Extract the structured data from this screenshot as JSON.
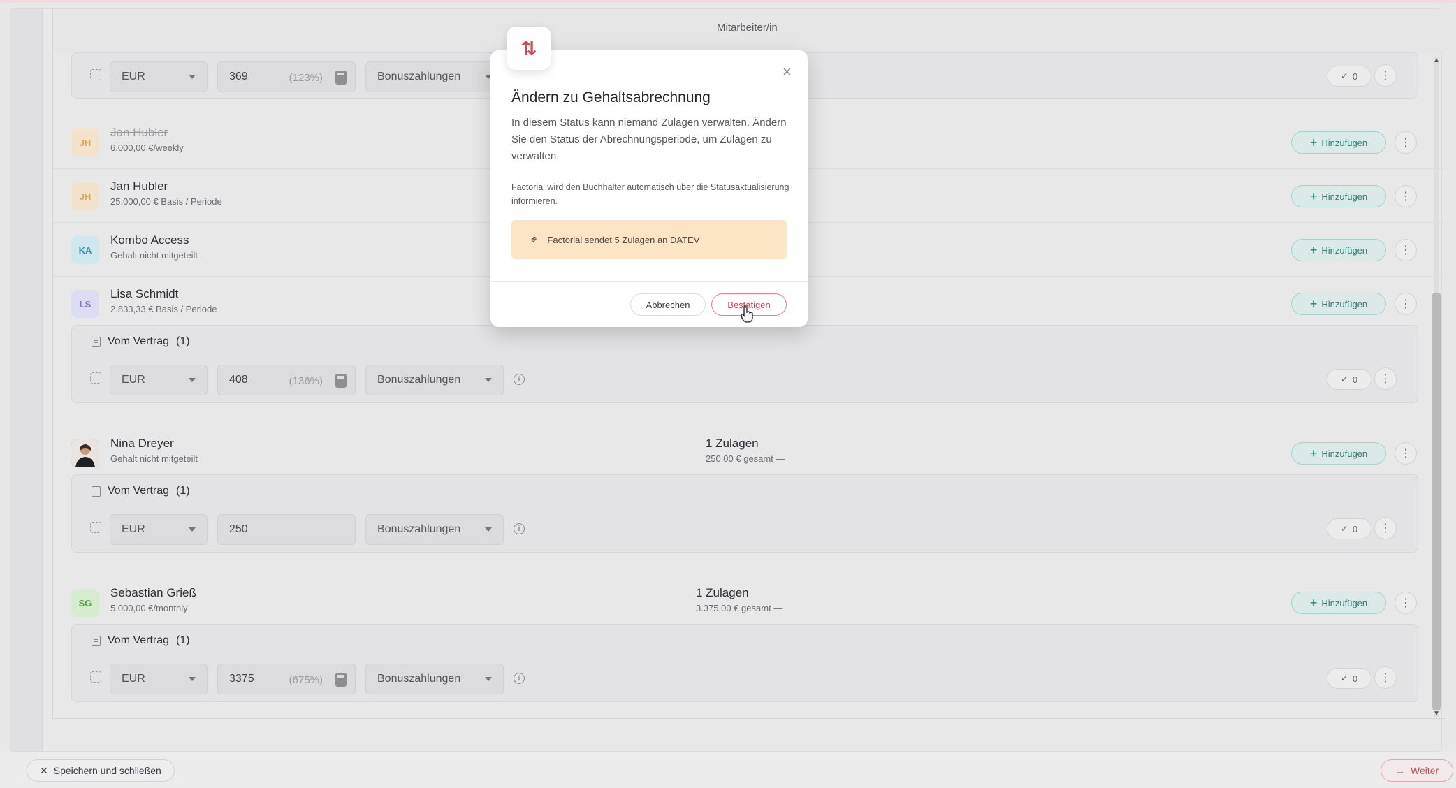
{
  "header": {
    "column_title": "Mitarbeiter/in"
  },
  "top_item": {
    "currency": "EUR",
    "amount": "369",
    "pct": "(123%)",
    "type": "Bonuszahlungen",
    "checks": "0"
  },
  "people": [
    {
      "initials": "JH",
      "name": "Jan Hubler",
      "sub": "6.000,00 €/weekly",
      "struck": true,
      "avatar_bg": "#f3e3cd",
      "avatar_fg": "#d8a55c"
    },
    {
      "initials": "JH",
      "name": "Jan Hubler",
      "sub": "25.000,00 € Basis / Periode",
      "avatar_bg": "#f3e3cd",
      "avatar_fg": "#d8a55c"
    },
    {
      "initials": "KA",
      "name": "Kombo Access",
      "sub": "Gehalt nicht mitgeteilt",
      "avatar_bg": "#cfe7ef",
      "avatar_fg": "#3f8faa"
    },
    {
      "initials": "LS",
      "name": "Lisa Schmidt",
      "sub": "2.833,33 € Basis / Periode",
      "avatar_bg": "#dcdcf3",
      "avatar_fg": "#7a78c7"
    },
    {
      "initials": "",
      "name": "Nina Dreyer",
      "sub": "Gehalt nicht mitgeteilt",
      "zulagen": "1 Zulagen",
      "sum": "250,00 € gesamt",
      "dash": "—"
    },
    {
      "initials": "SG",
      "name": "Sebastian Grieß",
      "sub": "5.000,00 €/monthly",
      "zulagen": "1 Zulagen",
      "sum": "3.375,00 € gesamt",
      "dash": "—",
      "avatar_bg": "#d6eccf",
      "avatar_fg": "#5aa24a"
    }
  ],
  "add_label": "Hinzufügen",
  "add_icon": "plus-icon",
  "vertrag_label": "Vom Vertrag",
  "vertrag_count": "(1)",
  "items": [
    {
      "currency": "EUR",
      "amount": "408",
      "pct": "(136%)",
      "type": "Bonuszahlungen",
      "checks": "0"
    },
    {
      "currency": "EUR",
      "amount": "250",
      "pct": "",
      "type": "Bonuszahlungen",
      "checks": "0"
    },
    {
      "currency": "EUR",
      "amount": "3375",
      "pct": "(675%)",
      "type": "Bonuszahlungen",
      "checks": "0"
    }
  ],
  "footer": {
    "save_label": "Speichern und schließen",
    "next_label": "Weiter"
  },
  "modal": {
    "title": "Ändern zu Gehaltsabrechnung",
    "description": "In diesem Status kann niemand Zulagen verwalten. Ändern Sie den Status der Abrechnungsperiode, um Zulagen zu verwalten.",
    "note": "Factorial wird den Buchhalter automatisch über die Statusaktualisierung informieren.",
    "banner": "Factorial sendet 5 Zulagen an DATEV",
    "cancel_label": "Abbrechen",
    "confirm_label": "Bestätigen"
  },
  "colors": {
    "accent": "#c54a57",
    "teal": "#2f7e77",
    "warning_bg": "#fbe5c5"
  }
}
